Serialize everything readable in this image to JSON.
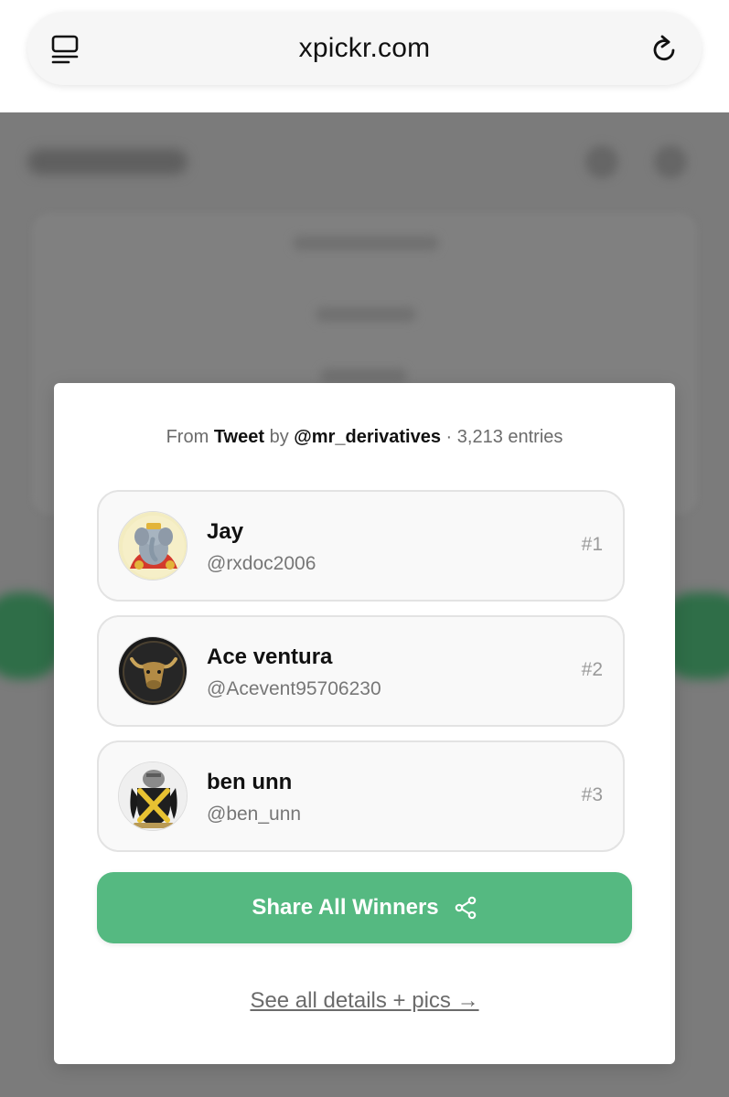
{
  "browser": {
    "url": "xpickr.com"
  },
  "modal": {
    "header": {
      "prefix": "From",
      "source": "Tweet",
      "by": "by",
      "author": "@mr_derivatives",
      "entries": "· 3,213 entries"
    },
    "winners": [
      {
        "name": "Jay",
        "handle": "@rxdoc2006",
        "rank": "#1",
        "avatar": "elephant-deity-avatar"
      },
      {
        "name": "Ace ventura",
        "handle": "@Acevent95706230",
        "rank": "#2",
        "avatar": "golden-bull-avatar"
      },
      {
        "name": "ben unn",
        "handle": "@ben_unn",
        "rank": "#3",
        "avatar": "coat-of-arms-avatar"
      }
    ],
    "share_label": "Share All Winners",
    "details_link": "See all details + pics →"
  },
  "colors": {
    "accent_green": "#55b981",
    "overlay_gray": "#7b7b7b"
  }
}
